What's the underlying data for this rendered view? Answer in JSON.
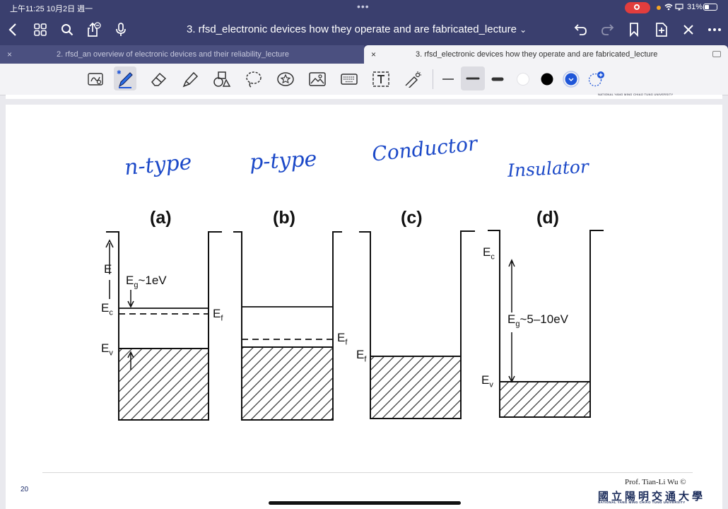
{
  "status_bar": {
    "time": "上午11:25  10月2日 週一",
    "dots": "•••",
    "battery": "31%"
  },
  "nav": {
    "title": "3. rfsd_electronic devices how they operate and are fabricated_lecture",
    "chevron": "⌄"
  },
  "tabs": [
    {
      "label": "2. rfsd_an overview of electronic devices and their reliability_lecture",
      "close": "×",
      "active": false
    },
    {
      "label": "3. rfsd_electronic devices how they operate and are fabricated_lecture",
      "close": "×",
      "active": true
    }
  ],
  "toolbar": {
    "tools": [
      "lasso-select-icon",
      "pen-icon",
      "eraser-icon",
      "highlighter-icon",
      "shapes-icon",
      "lasso-icon",
      "sticker-icon",
      "image-icon",
      "keyboard-icon",
      "text-box-icon",
      "laser-pointer-icon"
    ],
    "pen_colors": [
      "#ffffff",
      "#000000",
      "#1f56d8"
    ]
  },
  "slide": {
    "prev_logo": "NATIONAL YANG MING CHIAO TUNG UNIVERSITY",
    "handwriting": {
      "n_type": "n-type",
      "p_type": "p-type",
      "conductor": "Conductor",
      "insulator": "Insulator"
    },
    "panel_labels": {
      "a": "(a)",
      "b": "(b)",
      "c": "(c)",
      "d": "(d)"
    },
    "diagram_labels": {
      "e_axis": "E",
      "ec": "E",
      "ec_sub": "c",
      "ev": "E",
      "ev_sub": "v",
      "ef": "E",
      "ef_sub": "f",
      "eg_a": "E",
      "eg_sub": "g",
      "eg_a_val": "~1eV",
      "eg_d_val": "~5–10eV"
    },
    "page_number": "20",
    "credit": "Prof. Tian-Li Wu ©",
    "university_cn": "國立陽明交通大學",
    "university_en": "NATIONAL YANG MING CHIAO TUNG UNIVERSITY"
  },
  "colors": {
    "nav_bg": "#3a3f6e",
    "handwriting": "#1c49c8",
    "record": "#e23d3d"
  }
}
